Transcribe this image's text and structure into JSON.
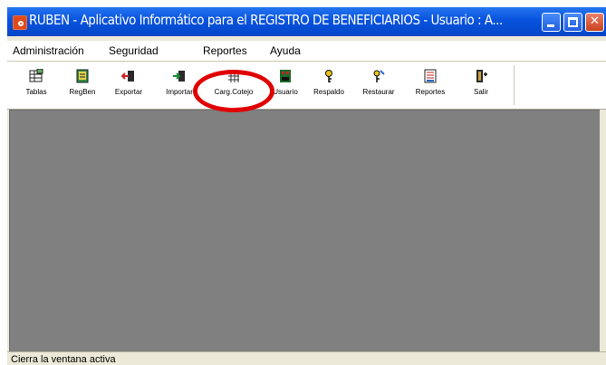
{
  "window": {
    "title": "RUBEN - Aplicativo Informático para el REGISTRO DE BENEFICIARIOS    - Usuario : A...",
    "controls": {
      "minimize": "minimize",
      "maximize": "maximize",
      "close": "close"
    }
  },
  "menu": {
    "items": [
      {
        "label": "Administración"
      },
      {
        "label": "Seguridad"
      },
      {
        "label": "Reportes"
      },
      {
        "label": "Ayuda"
      }
    ]
  },
  "toolbar": {
    "buttons": [
      {
        "label": "Tablas",
        "icon": "table-icon"
      },
      {
        "label": "RegBen",
        "icon": "register-icon"
      },
      {
        "label": "Exportar",
        "icon": "export-icon"
      },
      {
        "label": "Importar",
        "icon": "import-icon"
      },
      {
        "label": "Carg.Cotejo",
        "icon": "grid-load-icon"
      },
      {
        "label": "Usuario",
        "icon": "user-icon"
      },
      {
        "label": "Respaldo",
        "icon": "key-icon"
      },
      {
        "label": "Restaurar",
        "icon": "restore-key-icon"
      },
      {
        "label": "Reportes",
        "icon": "report-icon"
      },
      {
        "label": "Salir",
        "icon": "exit-door-icon"
      }
    ]
  },
  "annotation": {
    "color": "#e10000",
    "target": "Carg.Cotejo"
  },
  "statusbar": {
    "text": "Cierra la ventana activa"
  },
  "colors": {
    "titlebar": "#0853de",
    "client_area": "#808080",
    "chrome": "#ece9d8"
  }
}
